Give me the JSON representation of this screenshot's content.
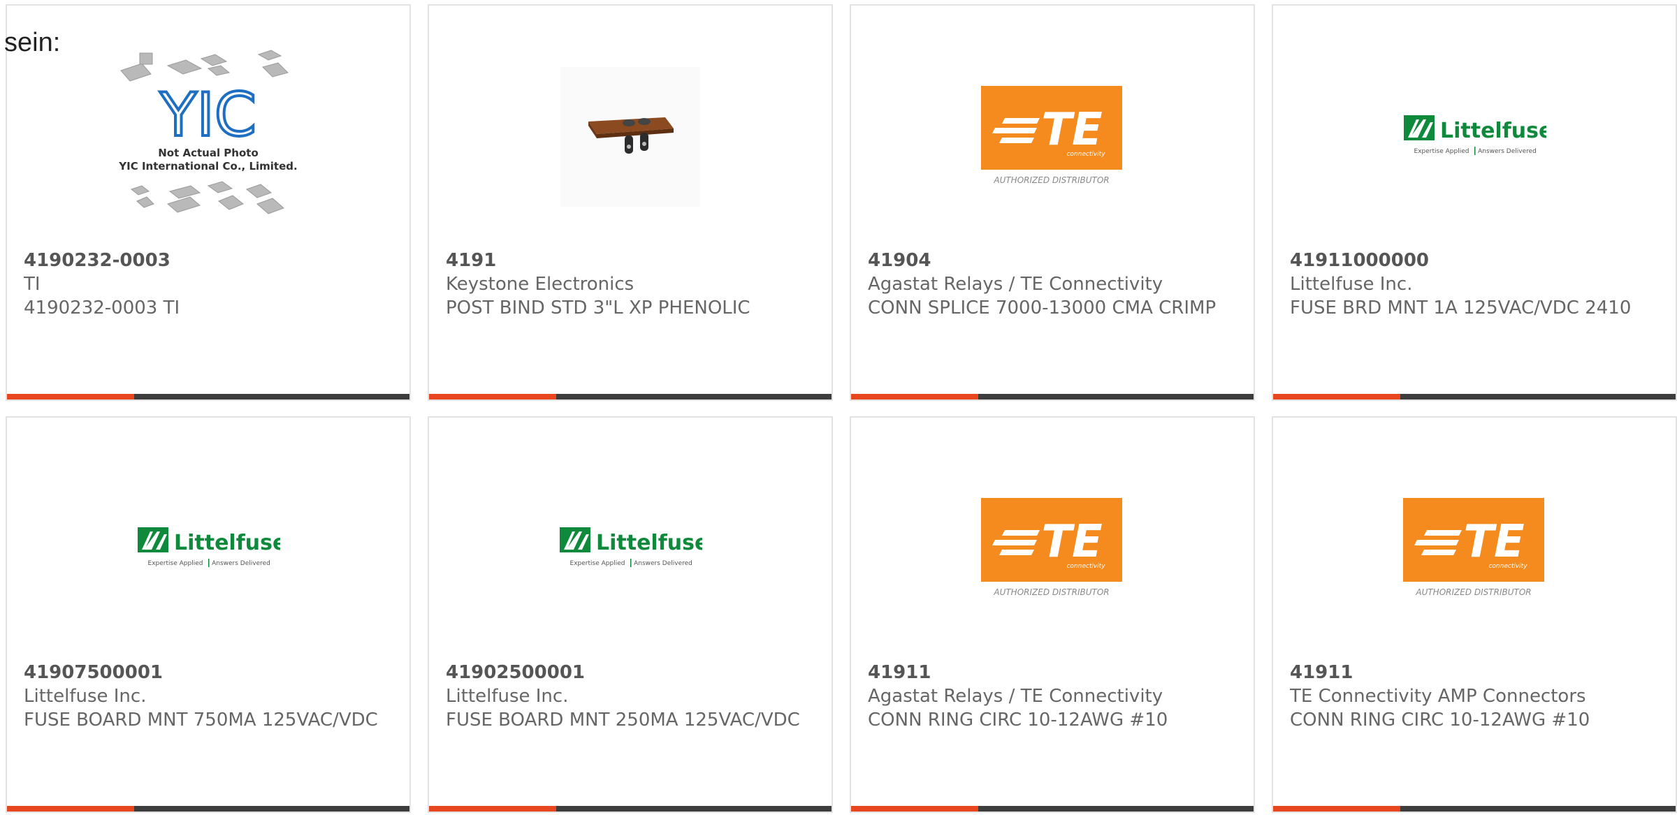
{
  "page": {
    "heading": "sein:"
  },
  "colors": {
    "accent": "#e8461f",
    "bar_dark": "#3d3d3d",
    "te_orange": "#f58b1f",
    "littelfuse_green": "#0f8a3c",
    "yic_blue": "#1e6fc1"
  },
  "logos": {
    "yic": {
      "icon": "yic-placeholder-logo",
      "letters": "YIC",
      "line1": "Not Actual Photo",
      "line2": "YIC International Co., Limited."
    },
    "te": {
      "icon": "te-connectivity-logo",
      "letters": "TE",
      "sub": "connectivity",
      "tag": "AUTHORIZED DISTRIBUTOR"
    },
    "littelfuse": {
      "icon": "littelfuse-logo",
      "name": "Littelfuse",
      "tagline_left": "Expertise Applied",
      "tagline_right": "Answers Delivered"
    },
    "keystone": {
      "icon": "binding-post-photo"
    }
  },
  "products": [
    {
      "part_number": "4190232-0003",
      "manufacturer": "TI",
      "description": "4190232-0003 TI",
      "image": "yic"
    },
    {
      "part_number": "4191",
      "manufacturer": "Keystone Electronics",
      "description": "POST BIND STD 3\"L XP PHENOLIC",
      "image": "keystone"
    },
    {
      "part_number": "41904",
      "manufacturer": "Agastat Relays / TE Connectivity",
      "description": "CONN SPLICE 7000-13000 CMA CRIMP",
      "image": "te"
    },
    {
      "part_number": "41911000000",
      "manufacturer": "Littelfuse Inc.",
      "description": "FUSE BRD MNT 1A 125VAC/VDC 2410",
      "image": "littelfuse"
    },
    {
      "part_number": "41907500001",
      "manufacturer": "Littelfuse Inc.",
      "description": "FUSE BOARD MNT 750MA 125VAC/VDC",
      "image": "littelfuse"
    },
    {
      "part_number": "41902500001",
      "manufacturer": "Littelfuse Inc.",
      "description": "FUSE BOARD MNT 250MA 125VAC/VDC",
      "image": "littelfuse"
    },
    {
      "part_number": "41911",
      "manufacturer": "Agastat Relays / TE Connectivity",
      "description": "CONN RING CIRC 10-12AWG #10",
      "image": "te"
    },
    {
      "part_number": "41911",
      "manufacturer": "TE Connectivity AMP Connectors",
      "description": "CONN RING CIRC 10-12AWG #10",
      "image": "te"
    }
  ]
}
